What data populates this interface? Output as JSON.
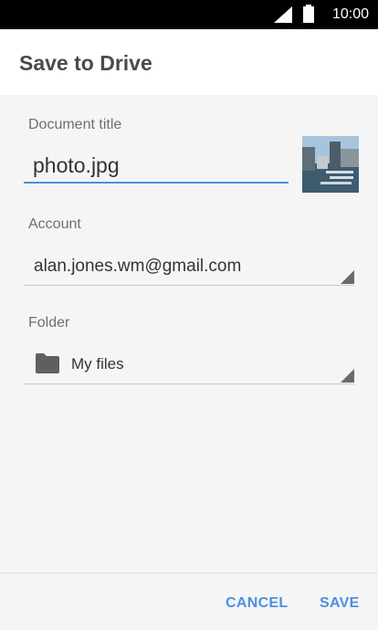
{
  "status_bar": {
    "time": "10:00"
  },
  "dialog": {
    "title": "Save to Drive",
    "document_title": {
      "label": "Document title",
      "value": "photo.jpg"
    },
    "account": {
      "label": "Account",
      "value": "alan.jones.wm@gmail.com"
    },
    "folder": {
      "label": "Folder",
      "value": "My files",
      "icon": "folder-icon"
    },
    "buttons": {
      "cancel": "CANCEL",
      "save": "SAVE"
    }
  },
  "colors": {
    "accent": "#4a90e2",
    "header_bg": "#ffffff",
    "body_bg": "#f5f5f5"
  }
}
